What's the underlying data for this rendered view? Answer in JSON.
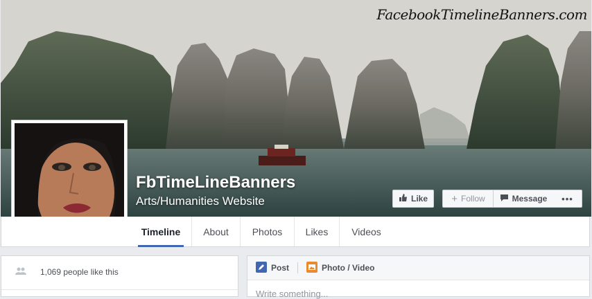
{
  "watermark": "FacebookTimelineBanners.com",
  "page": {
    "name": "FbTimeLineBanners",
    "category": "Arts/Humanities Website"
  },
  "actions": {
    "like": "Like",
    "follow": "Follow",
    "message": "Message",
    "more": "•••"
  },
  "tabs": [
    {
      "label": "Timeline",
      "active": true
    },
    {
      "label": "About"
    },
    {
      "label": "Photos"
    },
    {
      "label": "Likes"
    },
    {
      "label": "Videos"
    }
  ],
  "sidebar": {
    "likes_text": "1,069 people like this"
  },
  "composer": {
    "post_label": "Post",
    "photo_video_label": "Photo / Video",
    "placeholder": "Write something..."
  },
  "colors": {
    "accent": "#4267b2",
    "post_icon": "#4267b2",
    "photo_icon": "#e88a2d"
  }
}
